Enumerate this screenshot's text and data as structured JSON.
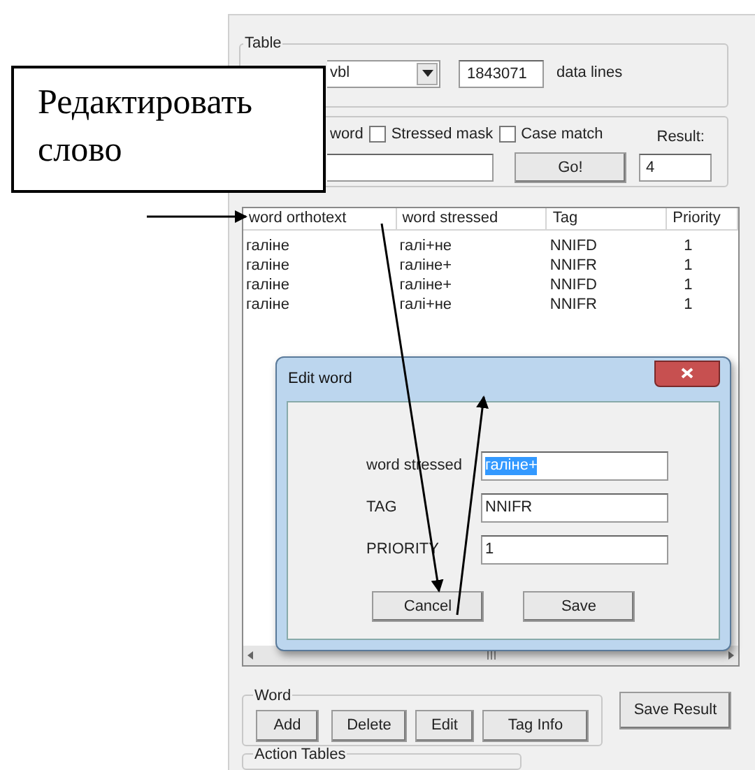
{
  "table_group": {
    "title": "Table",
    "table_select": "vbl",
    "line_count": "1843071",
    "line_count_label": "data lines"
  },
  "search_group": {
    "options": [
      {
        "label": "word"
      },
      {
        "label": "Stressed mask",
        "checked": false
      },
      {
        "label": "Case match",
        "checked": false
      }
    ],
    "go_button": "Go!",
    "result_label": "Result:",
    "result": "4"
  },
  "word_list": {
    "columns": [
      "word orthotext",
      "word stressed",
      "Tag",
      "Priority"
    ],
    "rows": [
      [
        "галіне",
        "галі+не",
        "NNIFD",
        "1"
      ],
      [
        "галіне",
        "галіне+",
        "NNIFR",
        "1"
      ],
      [
        "галіне",
        "галіне+",
        "NNIFD",
        "1"
      ],
      [
        "галіне",
        "галі+не",
        "NNIFR",
        "1"
      ]
    ]
  },
  "edit_dialog": {
    "title": "Edit word",
    "fields": [
      {
        "label": "word stressed",
        "value": "галіне+",
        "text_selected": true
      },
      {
        "label": "TAG",
        "value": "NNIFR",
        "text_selected": false
      },
      {
        "label": "PRIORITY",
        "value": "1",
        "text_selected": false
      }
    ],
    "buttons": [
      "Cancel",
      "Save"
    ]
  },
  "word_group": {
    "title": "Word",
    "buttons": [
      "Add",
      "Delete",
      "Edit",
      "Tag Info"
    ]
  },
  "save_result_button": "Save Result",
  "action_tables_group": {
    "title": "Action Tables"
  },
  "callout": {
    "text": "Редактировать слово"
  }
}
